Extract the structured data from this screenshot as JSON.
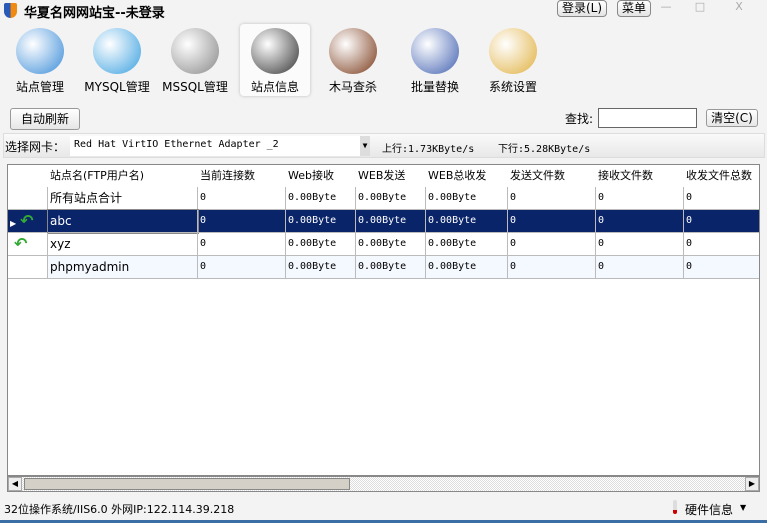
{
  "window": {
    "title": "华夏名网网站宝--未登录",
    "login": "登录(L)",
    "menu": "菜单",
    "minimize": "—",
    "maximize": "□",
    "close": "X"
  },
  "tabs": [
    {
      "label": "站点管理",
      "icon": "globe-server-icon",
      "color": "#3a8cd8",
      "active": false
    },
    {
      "label": "MYSQL管理",
      "icon": "dolphin-icon",
      "color": "#3aa0e0",
      "active": false
    },
    {
      "label": "MSSQL管理",
      "icon": "database-icon",
      "color": "#888888",
      "active": false
    },
    {
      "label": "站点信息",
      "icon": "info-icon",
      "color": "#333333",
      "active": true
    },
    {
      "label": "木马查杀",
      "icon": "horse-icon",
      "color": "#7a3a1a",
      "active": false
    },
    {
      "label": "批量替换",
      "icon": "magnifier-pencil-icon",
      "color": "#4060b0",
      "active": false
    },
    {
      "label": "系统设置",
      "icon": "settings-tools-icon",
      "color": "#e0b040",
      "active": false
    }
  ],
  "toolbar": {
    "auto_refresh": "自动刷新",
    "search_label": "查找:",
    "search_value": "",
    "clear": "清空(C)"
  },
  "nic": {
    "label": "选择网卡：",
    "selected": "Red Hat VirtIO Ethernet Adapter _2",
    "upload": "上行:1.73KByte/s",
    "download": "下行:5.28KByte/s"
  },
  "table": {
    "columns": [
      "站点名(FTP用户名)",
      "当前连接数",
      "Web接收",
      "WEB发送",
      "WEB总收发",
      "发送文件数",
      "接收文件数",
      "收发文件总数"
    ],
    "rows": [
      {
        "icon": false,
        "selected": false,
        "cells": [
          "所有站点合计",
          "0",
          "0.00Byte",
          "0.00Byte",
          "0.00Byte",
          "0",
          "0",
          "0"
        ]
      },
      {
        "icon": true,
        "selected": true,
        "cells": [
          "abc",
          "0",
          "0.00Byte",
          "0.00Byte",
          "0.00Byte",
          "0",
          "0",
          "0"
        ]
      },
      {
        "icon": true,
        "selected": false,
        "cells": [
          "xyz",
          "0",
          "0.00Byte",
          "0.00Byte",
          "0.00Byte",
          "0",
          "0",
          "0"
        ]
      },
      {
        "icon": false,
        "selected": false,
        "cells": [
          "phpmyadmin",
          "0",
          "0.00Byte",
          "0.00Byte",
          "0.00Byte",
          "0",
          "0",
          "0"
        ]
      }
    ]
  },
  "status": {
    "system": "32位操作系统/IIS6.0 外网IP:122.114.39.218",
    "hardware": "硬件信息"
  }
}
